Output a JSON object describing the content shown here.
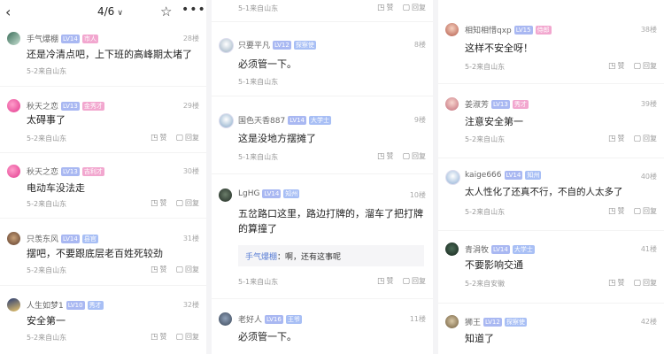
{
  "header": {
    "back_icon": "chevron-left-icon",
    "pager": "4/6",
    "star_icon": "star-outline-icon",
    "more_icon": "more-dots-icon"
  },
  "actions": {
    "like": "赞",
    "reply": "回复"
  },
  "col1": [
    {
      "user": "手气爆棚",
      "badges": [
        "LV14",
        "市人"
      ],
      "floor": "28楼",
      "text": "还是冷清点吧，上下班的高峰期太堵了",
      "meta": "5-2来自山东"
    },
    {
      "user": "秋天之恋",
      "badges": [
        "LV13",
        "金秀才"
      ],
      "floor": "29楼",
      "text": "太碍事了",
      "meta": "5-2来自山东"
    },
    {
      "user": "秋天之恋",
      "badges": [
        "LV13",
        "吉利才"
      ],
      "floor": "30楼",
      "text": "电动车没法走",
      "meta": "5-2来自山东"
    },
    {
      "user": "只羡东风",
      "badges": [
        "LV14",
        "县官"
      ],
      "floor": "31楼",
      "text": "摆吧，不要跟底层老百姓死较劲",
      "meta": "5-2来自山东"
    },
    {
      "user": "人生如梦1",
      "badges": [
        "LV10",
        "秀才"
      ],
      "floor": "32楼",
      "text": "安全第一",
      "meta": "5-2来自山东"
    }
  ],
  "col2": {
    "top_meta": "5-1来自山东",
    "items": [
      {
        "user": "只要平凡",
        "badges": [
          "LV12",
          "探察使"
        ],
        "floor": "8楼",
        "text": "必须管一下。",
        "meta": "5-1来自山东"
      },
      {
        "user": "国色天香887",
        "badges": [
          "LV14",
          "大学士"
        ],
        "floor": "9楼",
        "text": "这是没地方摆摊了",
        "meta": "5-1来自山东"
      },
      {
        "user": "LgHG",
        "badges": [
          "LV14",
          "知州"
        ],
        "floor": "10楼",
        "text": "五岔路口这里，路边打牌的，溜车了把打牌的算撞了",
        "reply_user": "手气爆棚",
        "reply_text": "：啊，还有这事呢",
        "meta": "5-1来自山东"
      },
      {
        "user": "老好人",
        "badges": [
          "LV16",
          "王爷"
        ],
        "floor": "11楼",
        "text": "必须管一下。"
      }
    ]
  },
  "col3": [
    {
      "user": "相知相惜qxp",
      "badges": [
        "LV15",
        "侍郎"
      ],
      "floor": "38楼",
      "text": "这样不安全呀！",
      "meta": "5-2来自山东"
    },
    {
      "user": "姜淑芳",
      "badges": [
        "LV13",
        "秀才"
      ],
      "floor": "39楼",
      "text": "注意安全第一",
      "meta": "5-2来自山东"
    },
    {
      "user": "kaige666",
      "badges": [
        "LV14",
        "知州"
      ],
      "floor": "40楼",
      "text": "太人性化了还真不行，不自的人太多了",
      "meta": "5-2来自山东"
    },
    {
      "user": "青涓牧",
      "badges": [
        "LV14",
        "大学士"
      ],
      "floor": "41楼",
      "text": "不要影响交通",
      "meta": "5-2来自安徽"
    },
    {
      "user": "狮王",
      "badges": [
        "LV12",
        "探察使"
      ],
      "floor": "42楼",
      "text": "知道了"
    }
  ]
}
